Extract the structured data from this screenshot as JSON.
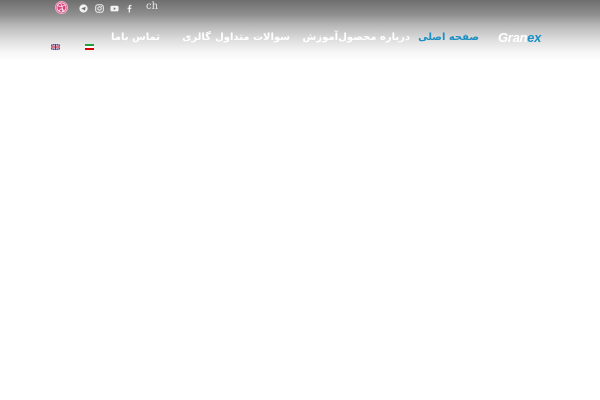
{
  "header": {
    "logo": {
      "part1": "Gran",
      "part2": "ex"
    },
    "nav": [
      {
        "label": "صفحه اصلی",
        "active": true
      },
      {
        "label": "درباره محصول",
        "active": false
      },
      {
        "label": "آموزش",
        "active": false
      },
      {
        "label": "سوالات متداول",
        "active": false
      },
      {
        "label": "گالری",
        "active": false
      },
      {
        "label": "تماس باما",
        "active": false
      }
    ],
    "languages": [
      {
        "code": "fa",
        "icon": "iran-flag-icon"
      },
      {
        "code": "en",
        "icon": "uk-flag-icon"
      }
    ]
  },
  "social_bar": {
    "text": "ch",
    "icons": [
      "dribbble-icon",
      "telegram-icon",
      "instagram-icon",
      "youtube-icon",
      "facebook-icon"
    ]
  },
  "colors": {
    "accent": "#1b8fc4",
    "header_dark": "#6e6e6e",
    "dribbble": "#d6457d",
    "text_light": "#ffffff"
  }
}
